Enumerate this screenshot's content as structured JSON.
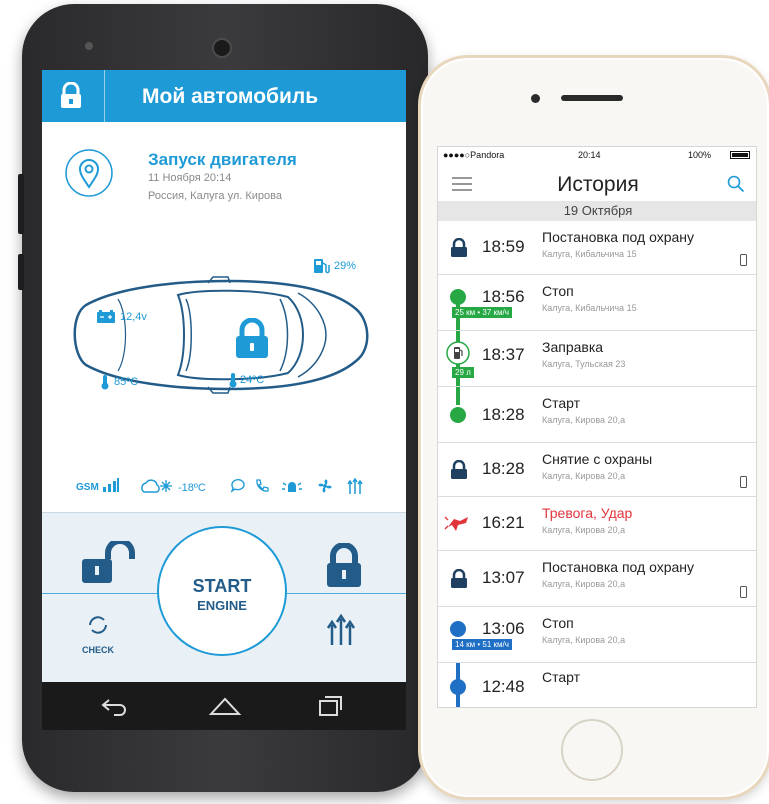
{
  "android": {
    "header": {
      "title": "Мой автомобиль"
    },
    "event": {
      "title": "Запуск двигателя",
      "date": "11 Ноября 20:14",
      "location": "Россия, Калуга ул. Кирова"
    },
    "car": {
      "fuel": "29%",
      "battery": "12,4v",
      "engine_temp": "85ºC",
      "cabin_temp": "24ºC"
    },
    "status": {
      "gsm_label": "GSM",
      "outside_temp": "-18ºC"
    },
    "controls": {
      "start_label": "START",
      "engine_label": "ENGINE",
      "check_label": "CHECK"
    },
    "colors": {
      "accent": "#1e9ad6",
      "dark_blue": "#235c88",
      "panel_bg": "#e9f1f6"
    }
  },
  "iphone": {
    "status": {
      "carrier": "●●●●○Pandora",
      "time": "20:14",
      "battery": "100%"
    },
    "title": "История",
    "date_header": "19 Октября",
    "events": [
      {
        "time": "18:59",
        "title": "Постановка под охрану",
        "address": "Калуга, Кибальчича 15",
        "icon": "lock-icon"
      },
      {
        "time": "18:56",
        "title": "Стоп",
        "address": "Калуга, Кибальчича 15",
        "badge": "25 км • 37 км/ч",
        "icon": "stop-dot-icon"
      },
      {
        "time": "18:37",
        "title": "Заправка",
        "address": "Калуга, Тульская 23",
        "badge": "29 л",
        "icon": "fuel-icon"
      },
      {
        "time": "18:28",
        "title": "Старт",
        "address": "Калуга, Кирова 20,а",
        "icon": "start-dot-icon"
      },
      {
        "time": "18:28",
        "title": "Снятие с охраны",
        "address": "Калуга, Кирова 20,а",
        "icon": "unlock-icon"
      },
      {
        "time": "16:21",
        "title": "Тревога, Удар",
        "address": "Калуга, Кирова 20,а",
        "icon": "alarm-icon"
      },
      {
        "time": "13:07",
        "title": "Постановка под охрану",
        "address": "Калуга, Кирова 20,а",
        "icon": "lock-icon"
      },
      {
        "time": "13:06",
        "title": "Стоп",
        "address": "Калуга, Кирова 20,а",
        "badge": "14 км • 51 км/ч",
        "icon": "stop-dot-icon"
      },
      {
        "time": "12:48",
        "title": "Старт",
        "icon": "start-dot-icon"
      }
    ],
    "colors": {
      "green": "#27a844",
      "blue": "#1f6fc4",
      "alarm": "#e2353b",
      "link": "#1e9ad6"
    }
  }
}
